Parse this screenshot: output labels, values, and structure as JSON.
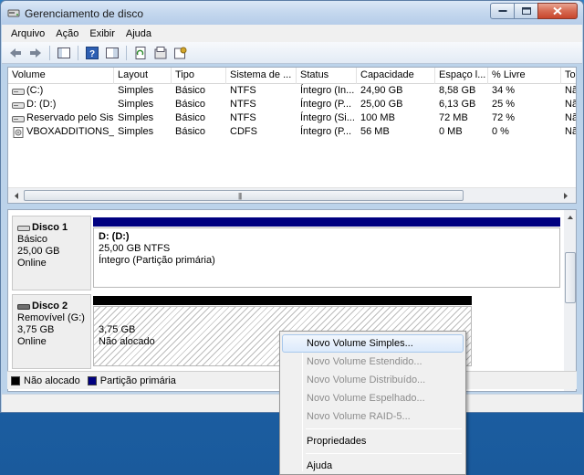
{
  "window": {
    "title": "Gerenciamento de disco"
  },
  "menu": [
    "Arquivo",
    "Ação",
    "Exibir",
    "Ajuda"
  ],
  "toolbar": {
    "icons": [
      "back-arrow-icon",
      "forward-arrow-icon",
      "console-tree-icon",
      "help-icon",
      "properties-icon",
      "refresh-icon",
      "export-icon",
      "settings-icon"
    ]
  },
  "volumes": {
    "columns": [
      "Volume",
      "Layout",
      "Tipo",
      "Sistema de ...",
      "Status",
      "Capacidade",
      "Espaço l...",
      "% Livre",
      "To"
    ],
    "rows": [
      [
        "(C:)",
        "Simples",
        "Básico",
        "NTFS",
        "Íntegro (In...",
        "24,90 GB",
        "8,58 GB",
        "34 %",
        "Nã"
      ],
      [
        "D: (D:)",
        "Simples",
        "Básico",
        "NTFS",
        "Íntegro (P...",
        "25,00 GB",
        "6,13 GB",
        "25 %",
        "Nã"
      ],
      [
        "Reservado pelo Sis...",
        "Simples",
        "Básico",
        "NTFS",
        "Íntegro (Si...",
        "100 MB",
        "72 MB",
        "72 %",
        "Nã"
      ],
      [
        "VBOXADDITIONS_...",
        "Simples",
        "Básico",
        "CDFS",
        "Íntegro (P...",
        "56 MB",
        "0 MB",
        "0 %",
        "Nã"
      ]
    ]
  },
  "disks": [
    {
      "name": "Disco 1",
      "type": "Básico",
      "size": "25,00 GB",
      "state": "Online",
      "partition": {
        "title": "D:  (D:)",
        "size": "25,00 GB NTFS",
        "status": "Íntegro (Partição primária)"
      }
    },
    {
      "name": "Disco 2",
      "type": "Removível (G:)",
      "size": "3,75 GB",
      "state": "Online",
      "partition": {
        "size": "3,75 GB",
        "status": "Não alocado"
      }
    }
  ],
  "legend": [
    {
      "label": "Não alocado",
      "color": "#000000"
    },
    {
      "label": "Partição primária",
      "color": "#000080"
    }
  ],
  "context_menu": {
    "items": [
      {
        "label": "Novo Volume Simples...",
        "enabled": true,
        "highlighted": true
      },
      {
        "label": "Novo Volume Estendido...",
        "enabled": false
      },
      {
        "label": "Novo Volume Distribuído...",
        "enabled": false
      },
      {
        "label": "Novo Volume Espelhado...",
        "enabled": false
      },
      {
        "label": "Novo Volume RAID-5...",
        "enabled": false
      },
      {
        "label": "Propriedades",
        "enabled": true
      },
      {
        "label": "Ajuda",
        "enabled": true
      }
    ]
  },
  "colors": {
    "primary_partition": "#000080",
    "unallocated": "#000000",
    "titlebar": "#c4d7ee"
  }
}
